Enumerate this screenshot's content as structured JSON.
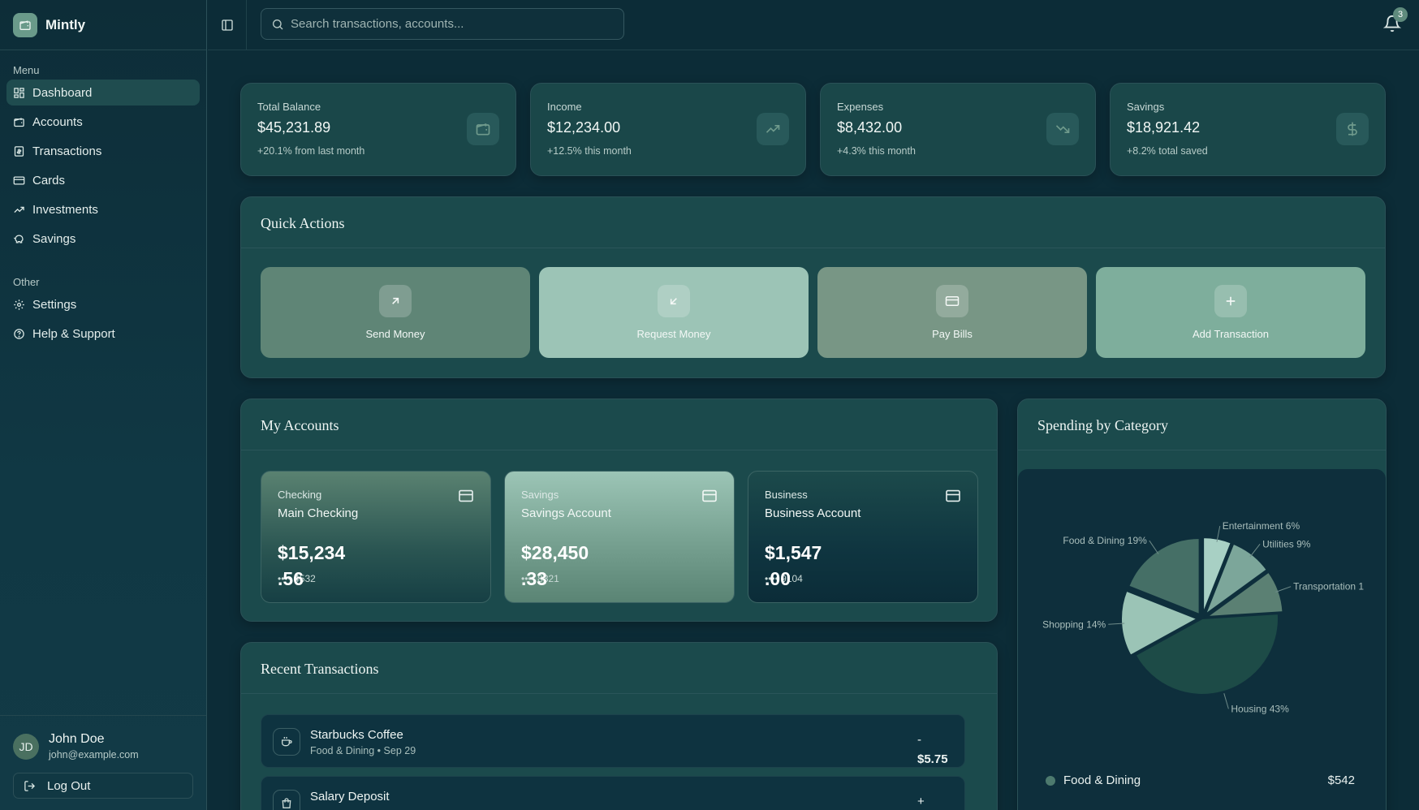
{
  "brand": {
    "name": "Mintly"
  },
  "sidebar": {
    "menu_label": "Menu",
    "menu_items": [
      {
        "label": "Dashboard",
        "icon": "dashboard-icon",
        "active": true
      },
      {
        "label": "Accounts",
        "icon": "wallet-icon"
      },
      {
        "label": "Transactions",
        "icon": "receipt-icon"
      },
      {
        "label": "Cards",
        "icon": "credit-card-icon"
      },
      {
        "label": "Investments",
        "icon": "trending-up-icon"
      },
      {
        "label": "Savings",
        "icon": "piggy-bank-icon"
      }
    ],
    "other_label": "Other",
    "other_items": [
      {
        "label": "Settings",
        "icon": "gear-icon"
      },
      {
        "label": "Help & Support",
        "icon": "help-circle-icon"
      }
    ],
    "user": {
      "initials": "JD",
      "name": "John Doe",
      "email": "john@example.com"
    },
    "logout_label": "Log Out"
  },
  "header": {
    "search_placeholder": "Search transactions, accounts...",
    "notification_count": "3"
  },
  "stats": [
    {
      "label": "Total Balance",
      "value": "$45,231.89",
      "delta": "+20.1% from last month",
      "icon": "wallet-icon"
    },
    {
      "label": "Income",
      "value": "$12,234.00",
      "delta": "+12.5% this month",
      "icon": "trending-up-icon"
    },
    {
      "label": "Expenses",
      "value": "$8,432.00",
      "delta": "+4.3% this month",
      "icon": "trending-down-icon"
    },
    {
      "label": "Savings",
      "value": "$18,921.42",
      "delta": "+8.2% total saved",
      "icon": "dollar-icon"
    }
  ],
  "quick_actions": {
    "title": "Quick Actions",
    "items": [
      {
        "label": "Send Money",
        "icon": "arrow-up-right-icon",
        "color": "#5f8576"
      },
      {
        "label": "Request Money",
        "icon": "arrow-down-left-icon",
        "color": "#9cc4b6"
      },
      {
        "label": "Pay Bills",
        "icon": "credit-card-icon",
        "color": "#789685"
      },
      {
        "label": "Add Transaction",
        "icon": "plus-icon",
        "color": "#7eae9c"
      }
    ]
  },
  "accounts": {
    "title": "My Accounts",
    "items": [
      {
        "type": "Checking",
        "name": "Main Checking",
        "balance": "$15,234",
        "cents": ".56",
        "number": "•••• 4532"
      },
      {
        "type": "Savings",
        "name": "Savings Account",
        "balance": "$28,450",
        "cents": ".33",
        "number": "•••• 8321"
      },
      {
        "type": "Business",
        "name": "Business Account",
        "balance": "$1,547",
        "cents": ".00",
        "number": "•••• 9104"
      }
    ]
  },
  "transactions": {
    "title": "Recent Transactions",
    "items": [
      {
        "name": "Starbucks Coffee",
        "meta": "Food & Dining • Sep 29",
        "sign": "-",
        "amount": "$5.75",
        "icon": "coffee-icon"
      },
      {
        "name": "Salary Deposit",
        "meta": "",
        "sign": "+",
        "amount": "",
        "icon": "shopping-bag-icon"
      }
    ]
  },
  "spending": {
    "title": "Spending by Category",
    "legend": [
      {
        "name": "Food & Dining",
        "value": "$542",
        "color": "#4d7a6e"
      }
    ]
  },
  "chart_data": {
    "type": "pie",
    "title": "Spending by Category",
    "slices": [
      {
        "label": "Entertainment 6%",
        "value": 6,
        "color": "#a8d0c4"
      },
      {
        "label": "Utilities 9%",
        "value": 9,
        "color": "#7ca69a"
      },
      {
        "label": "Transportation 1",
        "value": 9,
        "color": "#5b8073"
      },
      {
        "label": "Housing 43%",
        "value": 43,
        "color": "#1d4b47"
      },
      {
        "label": "Shopping 14%",
        "value": 14,
        "color": "#9bc4b6"
      },
      {
        "label": "Food & Dining 19%",
        "value": 19,
        "color": "#456f66"
      }
    ]
  }
}
